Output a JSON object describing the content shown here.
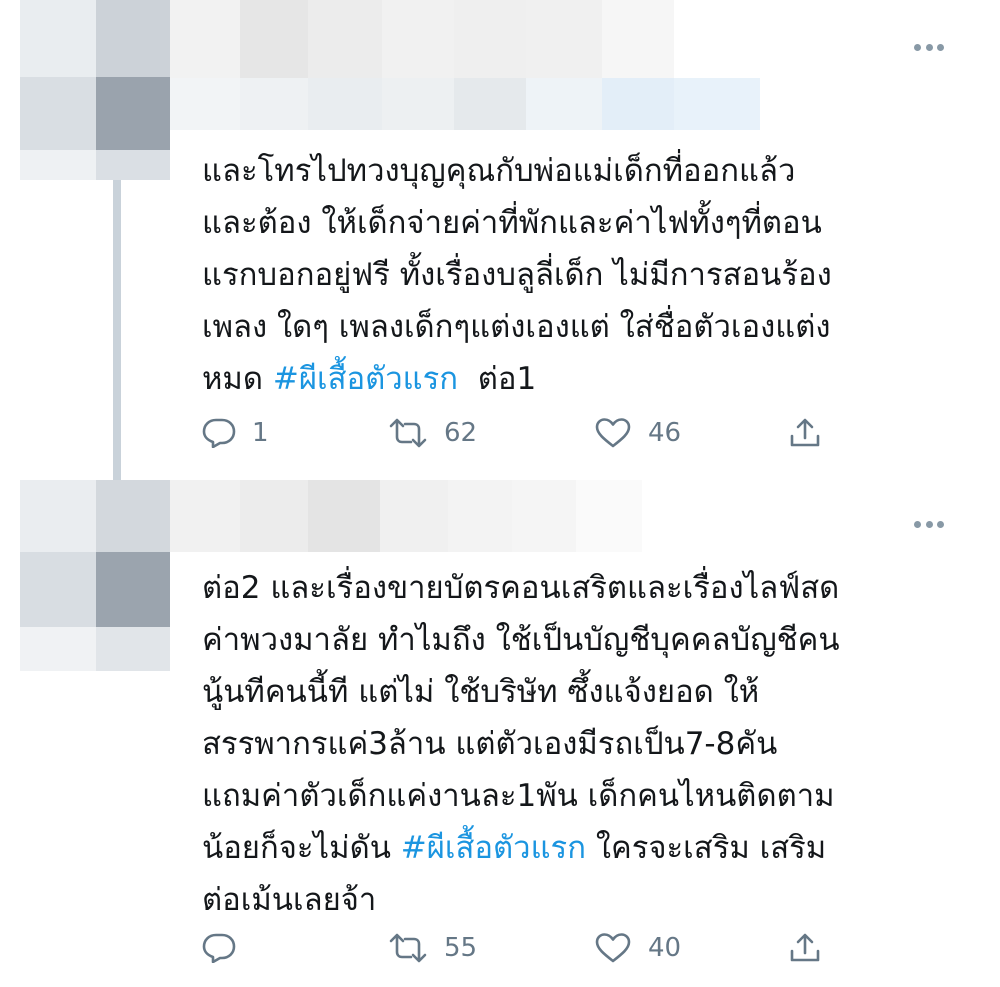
{
  "colors": {
    "text": "#14171a",
    "hashtag": "#1b95e0",
    "icon": "#657786",
    "thread_line": "#c9d2da"
  },
  "tweets": [
    {
      "text_lines": [
        "และโทรไปทวงบุญคุณกับพ่อแม่เด็กที่ออกแล้ว",
        "และต้อง ให้เด็กจ่ายค่าที่พักและค่าไฟทั้งๆที่ตอน",
        "แรกบอกอยู่ฟรี ทั้งเรื่องบลูลี่เด็ก ไม่มีการสอนร้อง",
        "เพลง ใดๆ เพลงเด็กๆแต่งเองแต่ ใส่ชื่อตัวเองแต่ง"
      ],
      "last_line_prefix": "หมด ",
      "hashtag": "#ผีเสื้อตัวแรก",
      "last_line_suffix": "  ต่อ1",
      "reply_count": "1",
      "retweet_count": "62",
      "like_count": "46"
    },
    {
      "text_lines": [
        "ต่อ2 และเรื่องขายบัตรคอนเสริตและเรื่องไลฟ์สด",
        "ค่าพวงมาลัย ทำไมถึง ใช้เป็นบัญชีบุคคลบัญชีคน",
        "นู้นทีคนนี้ที แต่ไม่ ใช้บริษัท ซึ้งแจ้งยอด ให้",
        "สรรพากรแค่3ล้าน แต่ตัวเองมีรถเป็น7-8คัน",
        "แถมค่าตัวเด็กแค่งานละ1พัน เด็กคนไหนติดตาม"
      ],
      "hashtag_line_prefix": "น้อยก็จะไม่ดัน ",
      "hashtag": "#ผีเสื้อตัวแรก",
      "hashtag_line_suffix": " ใครจะเสริม เสริม",
      "final_line": "ต่อเม้นเลยจ้า",
      "reply_count": "",
      "retweet_count": "55",
      "like_count": "40"
    }
  ]
}
